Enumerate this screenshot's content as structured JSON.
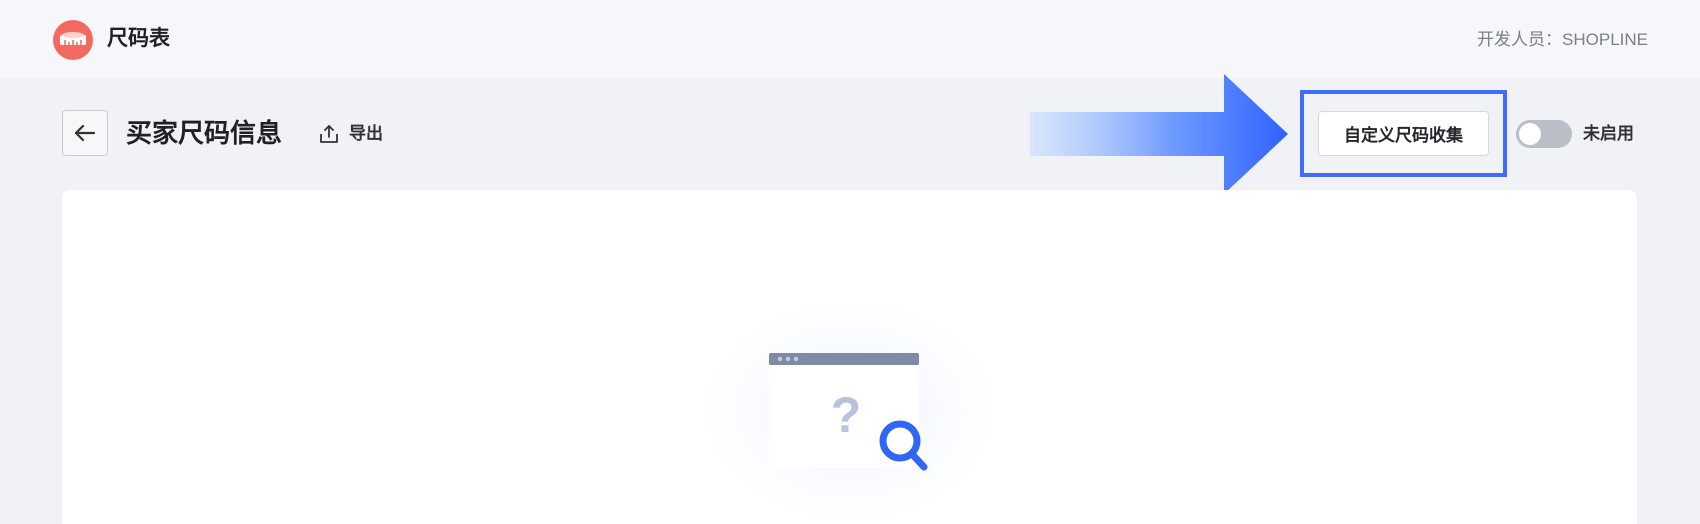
{
  "header": {
    "app_title": "尺码表",
    "developer": "开发人员：SHOPLINE"
  },
  "toolbar": {
    "page_title": "买家尺码信息",
    "export_label": "导出",
    "custom_collect_label": "自定义尺码收集",
    "toggle_label": "未启用",
    "toggle_enabled": false
  },
  "colors": {
    "accent": "#3d6dff",
    "logo": "#f26a5f",
    "toggle_off": "#b9bec7"
  },
  "icons": {
    "back": "arrow-left-icon",
    "export": "upload-icon",
    "empty": "empty-search-icon",
    "pointer": "arrow-right-icon"
  }
}
